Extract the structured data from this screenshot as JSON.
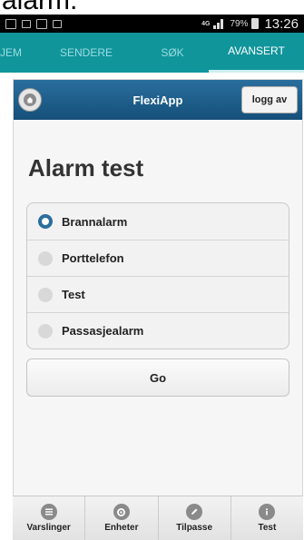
{
  "caption": "alarm.",
  "status_bar": {
    "network_type": "4G",
    "battery_percent": "79%",
    "time": "13:26"
  },
  "tabs": [
    {
      "label": "JEM",
      "active": false
    },
    {
      "label": "SENDERE",
      "active": false
    },
    {
      "label": "SØK",
      "active": false
    },
    {
      "label": "AVANSERT",
      "active": true
    }
  ],
  "app": {
    "title": "FlexiApp",
    "logout_label": "logg av",
    "page_title": "Alarm test",
    "options": [
      {
        "label": "Brannalarm",
        "selected": true
      },
      {
        "label": "Porttelefon",
        "selected": false
      },
      {
        "label": "Test",
        "selected": false
      },
      {
        "label": "Passasjealarm",
        "selected": false
      }
    ],
    "go_label": "Go"
  },
  "bottom_nav": [
    {
      "label": "Varslinger",
      "icon": "list-icon"
    },
    {
      "label": "Enheter",
      "icon": "gear-icon"
    },
    {
      "label": "Tilpasse",
      "icon": "pencil-icon"
    },
    {
      "label": "Test",
      "icon": "info-icon"
    }
  ],
  "colors": {
    "tab_bar": "#10959b",
    "header": "#1c5c87",
    "selected_radio": "#2a6e9e"
  }
}
